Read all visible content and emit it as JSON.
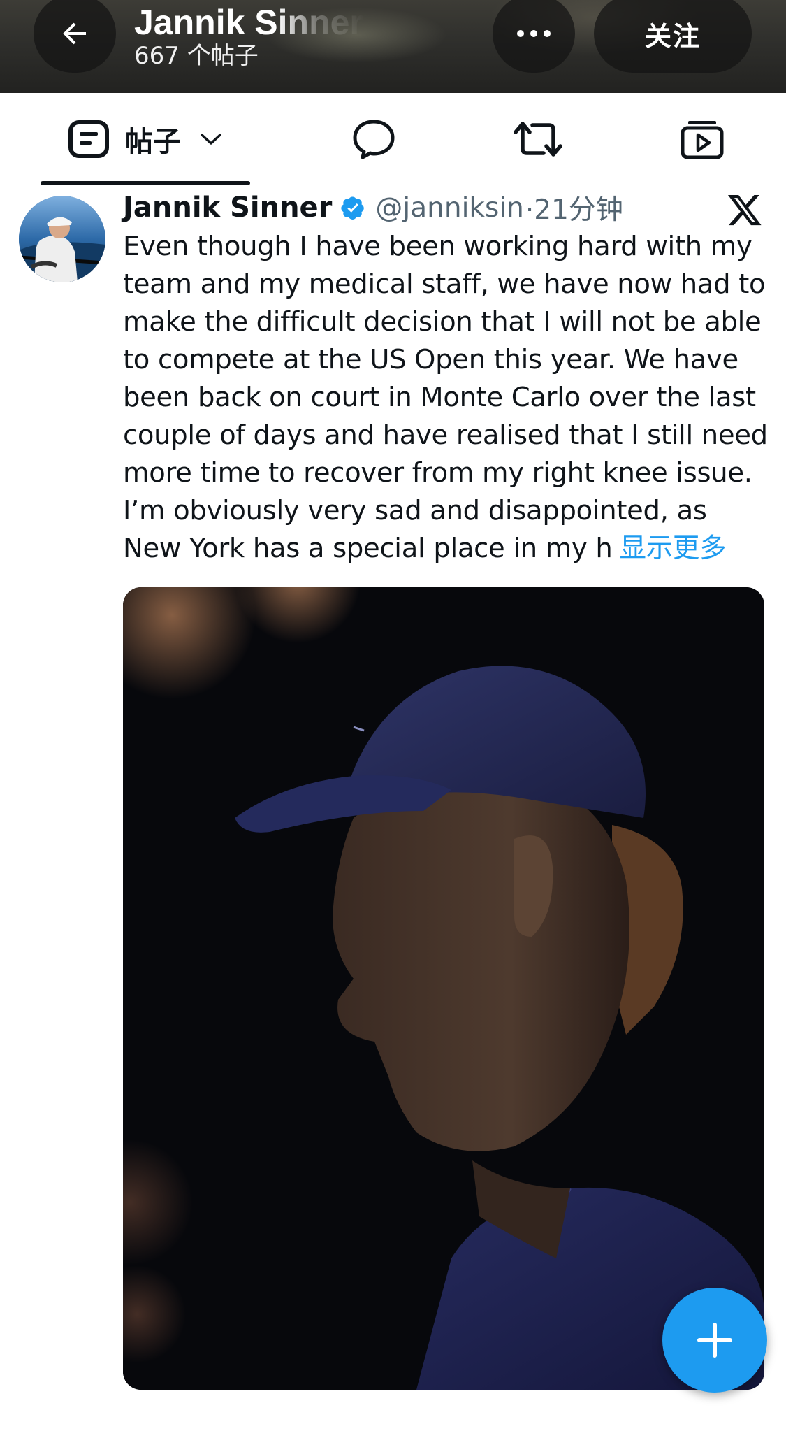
{
  "header": {
    "profile_name": "Jannik Sinner",
    "post_count_label": "667 个帖子",
    "follow_label": "关注"
  },
  "tabs": [
    {
      "label": "帖子",
      "icon": "posts-icon",
      "active": true
    },
    {
      "label": "",
      "icon": "replies-icon",
      "active": false
    },
    {
      "label": "",
      "icon": "repost-icon",
      "active": false
    },
    {
      "label": "",
      "icon": "video-icon",
      "active": false
    }
  ],
  "post": {
    "author_name": "Jannik Sinner",
    "handle": "@janniksin",
    "time": "·21分钟",
    "text_lines": [
      "Even though I have been working hard with my",
      "team and my medical staff, we have now had to",
      "make the difficult decision that I will not be able",
      "to compete at the US Open this year. We have",
      "been back on court in Monte Carlo over the last",
      "couple of days and have realised that I still need",
      "more time to recover from my right knee issue.",
      "I’m obviously very sad and disappointed, as",
      "New York has a special place in my h"
    ],
    "show_more": "显示更多"
  },
  "colors": {
    "accent": "#1d9bf0",
    "text_primary": "#0f1419",
    "text_secondary": "#536471",
    "header_bg": "#2f2f2c"
  }
}
